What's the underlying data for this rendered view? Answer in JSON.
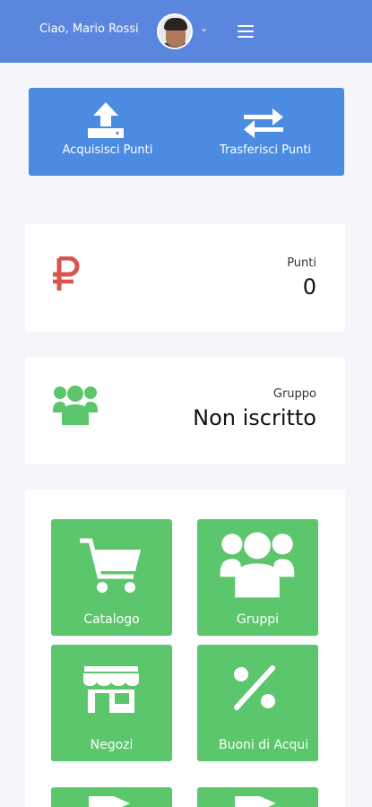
{
  "header": {
    "greeting": "Ciao, Mario Rossi",
    "chevron_icon": "chevron-down-icon",
    "menu_icon": "hamburger-menu-icon"
  },
  "actions": [
    {
      "label": "Acquisisci Punti",
      "icon": "upload-icon"
    },
    {
      "label": "Trasferisci Punti",
      "icon": "transfer-arrows-icon"
    }
  ],
  "points": {
    "label": "Punti",
    "value": "0",
    "icon": "ruble-currency-icon",
    "icon_color": "#d9534f"
  },
  "group": {
    "label": "Gruppo",
    "value": "Non iscritto",
    "icon": "users-group-icon",
    "icon_color": "#5cc66c"
  },
  "tiles": [
    {
      "label": "Catalogo",
      "icon": "shopping-cart-icon"
    },
    {
      "label": "Gruppi",
      "icon": "users-group-icon"
    },
    {
      "label": "Negozi",
      "icon": "store-icon"
    },
    {
      "label": "Buoni di Acqui",
      "icon": "percent-icon"
    }
  ],
  "colors": {
    "header": "#5b86de",
    "action_bar": "#4c8be2",
    "tile": "#5cc66c",
    "background": "#f4f6f9"
  }
}
